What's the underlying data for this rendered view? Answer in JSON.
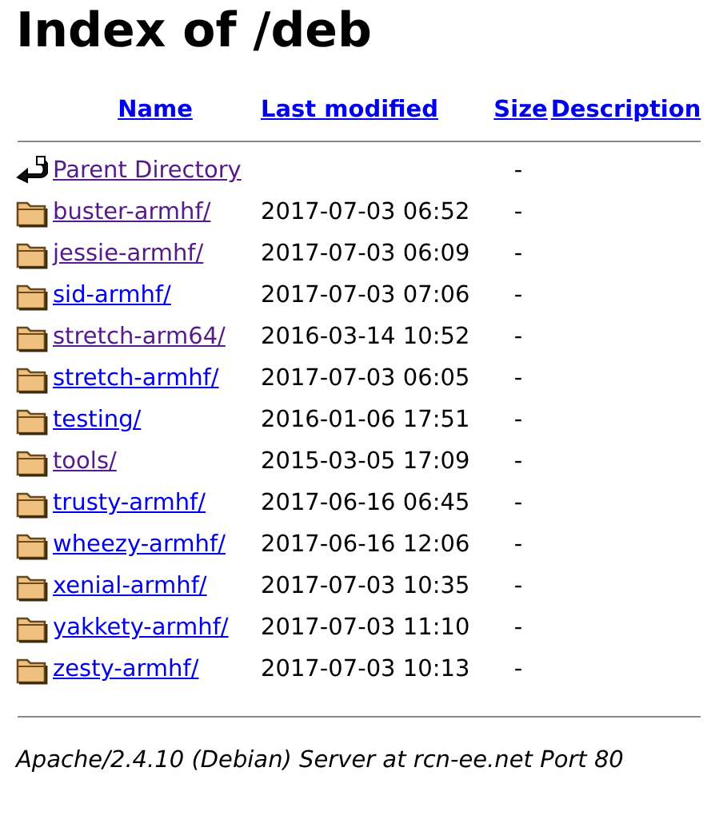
{
  "title": "Index of /deb",
  "columns": [
    {
      "label": "Name"
    },
    {
      "label": "Last modified"
    },
    {
      "label": "Size"
    },
    {
      "label": "Description"
    }
  ],
  "rows": [
    {
      "kind": "parent",
      "name": "Parent Directory",
      "modified": "",
      "size": "-",
      "visited": true
    },
    {
      "kind": "folder",
      "name": "buster-armhf/",
      "modified": "2017-07-03 06:52",
      "size": "-",
      "visited": true
    },
    {
      "kind": "folder",
      "name": "jessie-armhf/",
      "modified": "2017-07-03 06:09",
      "size": "-",
      "visited": true
    },
    {
      "kind": "folder",
      "name": "sid-armhf/",
      "modified": "2017-07-03 07:06",
      "size": "-",
      "visited": false
    },
    {
      "kind": "folder",
      "name": "stretch-arm64/",
      "modified": "2016-03-14 10:52",
      "size": "-",
      "visited": true
    },
    {
      "kind": "folder",
      "name": "stretch-armhf/",
      "modified": "2017-07-03 06:05",
      "size": "-",
      "visited": false
    },
    {
      "kind": "folder",
      "name": "testing/",
      "modified": "2016-01-06 17:51",
      "size": "-",
      "visited": false
    },
    {
      "kind": "folder",
      "name": "tools/",
      "modified": "2015-03-05 17:09",
      "size": "-",
      "visited": true
    },
    {
      "kind": "folder",
      "name": "trusty-armhf/",
      "modified": "2017-06-16 06:45",
      "size": "-",
      "visited": false
    },
    {
      "kind": "folder",
      "name": "wheezy-armhf/",
      "modified": "2017-06-16 12:06",
      "size": "-",
      "visited": false
    },
    {
      "kind": "folder",
      "name": "xenial-armhf/",
      "modified": "2017-07-03 10:35",
      "size": "-",
      "visited": false
    },
    {
      "kind": "folder",
      "name": "yakkety-armhf/",
      "modified": "2017-07-03 11:10",
      "size": "-",
      "visited": false
    },
    {
      "kind": "folder",
      "name": "zesty-armhf/",
      "modified": "2017-07-03 10:13",
      "size": "-",
      "visited": false
    }
  ],
  "footer": "Apache/2.4.10 (Debian) Server at rcn-ee.net Port 80"
}
